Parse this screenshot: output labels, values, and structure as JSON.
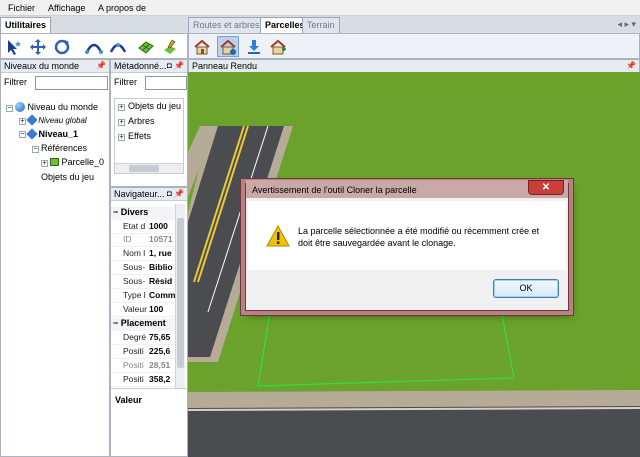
{
  "menu": {
    "items": [
      "Fichier",
      "Affichage",
      "A propos de"
    ]
  },
  "tabs_left": {
    "active": "Utilitaires"
  },
  "tabs_right": {
    "items": [
      {
        "label": "Routes et arbres",
        "active": false
      },
      {
        "label": "Parcelles",
        "active": true
      },
      {
        "label": "Terrain",
        "active": false
      }
    ]
  },
  "toolbar_left": {
    "icons": [
      "select-arrow-icon",
      "move-arrows-icon",
      "rotate-icon",
      "curve-road-icon",
      "curve-road-alt-icon",
      "grid-terrain-icon",
      "paint-terrain-icon"
    ]
  },
  "toolbar_right": {
    "icons": [
      "house-add-icon",
      "house-clone-icon",
      "download-arrow-icon",
      "house-plus-icon"
    ]
  },
  "world_panel": {
    "title": "Niveaux du monde",
    "filter_label": "Filtrer",
    "filter_value": "",
    "tree": [
      {
        "label": "Niveau du monde"
      },
      {
        "label": "Niveau global"
      },
      {
        "label": "Niveau_1"
      },
      {
        "label": "Références"
      },
      {
        "label": "Parcelle_0"
      },
      {
        "label": "Objets du jeu"
      }
    ]
  },
  "meta_panel": {
    "title": "Métadonné...",
    "filter_label": "Filtrer",
    "filter_value": "",
    "items": [
      "Objets du jeu",
      "Arbres",
      "Effets"
    ]
  },
  "nav_panel": {
    "title": "Navigateur...",
    "categories": [
      {
        "name": "Divers",
        "rows": [
          {
            "key": "Etat d",
            "value": "1000",
            "dim": false
          },
          {
            "key": "ID",
            "value": "10571",
            "dim": true
          },
          {
            "key": "Nom l",
            "value": "1, rue",
            "dim": false
          },
          {
            "key": "Sous-",
            "value": "Biblio",
            "dim": false
          },
          {
            "key": "Sous-",
            "value": "Résid",
            "dim": false
          },
          {
            "key": "Type l",
            "value": "Comm",
            "dim": false
          },
          {
            "key": "Valeur",
            "value": "100",
            "dim": false
          }
        ]
      },
      {
        "name": "Placement",
        "rows": [
          {
            "key": "Degré",
            "value": "75,65",
            "dim": false
          },
          {
            "key": "Positi",
            "value": "225,6",
            "dim": false
          },
          {
            "key": "Positi",
            "value": "28,51",
            "dim": true
          },
          {
            "key": "Positi",
            "value": "358,2",
            "dim": false
          }
        ]
      }
    ],
    "footer_label": "Valeur"
  },
  "render_panel": {
    "title": "Panneau Rendu"
  },
  "dialog": {
    "title": "Avertissement de l'outil Cloner la parcelle",
    "message": "La parcelle sélectionnée a été modifié ou récemment crée et doit être sauvegardée avant le clonage.",
    "ok_label": "OK",
    "close_label": "✕"
  },
  "colors": {
    "grass": "#6aa22c",
    "road": "#4a4c50",
    "sidewalk": "#b5ab96",
    "lane_yellow": "#e9c93a",
    "parcel_outline": "#2fe03a",
    "warning": "#f2c200"
  }
}
